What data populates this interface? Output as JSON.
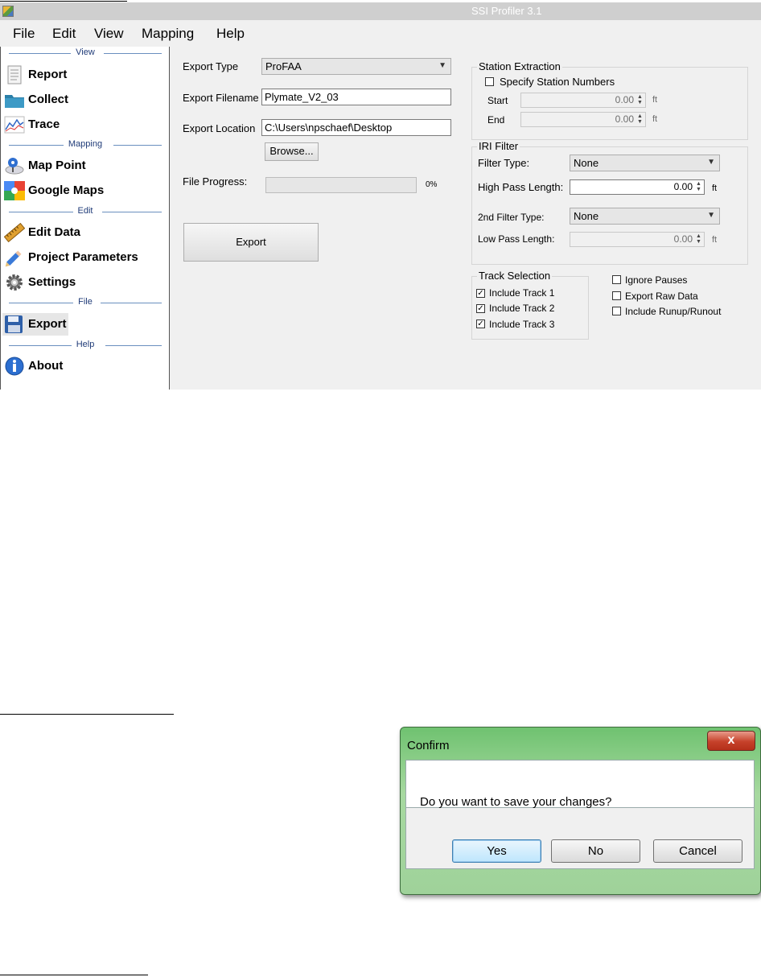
{
  "window": {
    "title": "SSI Profiler 3.1"
  },
  "menu": [
    "File",
    "Edit",
    "View",
    "Mapping",
    "Help"
  ],
  "sidebar": {
    "sections": [
      {
        "label": "View"
      },
      {
        "label": "Mapping"
      },
      {
        "label": "Edit"
      },
      {
        "label": "File"
      },
      {
        "label": "Help"
      }
    ],
    "items": [
      {
        "label": "Report",
        "icon": "report-icon"
      },
      {
        "label": "Collect",
        "icon": "folder-icon"
      },
      {
        "label": "Trace",
        "icon": "trace-chart-icon"
      },
      {
        "label": "Map Point",
        "icon": "map-pin-icon"
      },
      {
        "label": "Google Maps",
        "icon": "google-maps-icon"
      },
      {
        "label": "Edit Data",
        "icon": "ruler-icon"
      },
      {
        "label": "Project Parameters",
        "icon": "pencil-icon"
      },
      {
        "label": "Settings",
        "icon": "gear-icon"
      },
      {
        "label": "Export",
        "icon": "floppy-disk-icon",
        "active": true
      },
      {
        "label": "About",
        "icon": "info-icon"
      }
    ]
  },
  "export": {
    "type_label": "Export Type",
    "type_value": "ProFAA",
    "filename_label": "Export Filename",
    "filename_value": "Plymate_V2_03",
    "location_label": "Export Location",
    "location_value": "C:\\Users\\npschaef\\Desktop",
    "browse_label": "Browse...",
    "progress_label": "File Progress:",
    "progress_text": "0%",
    "progress_fraction": 0,
    "export_button": "Export"
  },
  "station_extraction": {
    "title": "Station Extraction",
    "specify_label": "Specify Station Numbers",
    "specify_checked": false,
    "start_label": "Start",
    "start_value": "0.00",
    "end_label": "End",
    "end_value": "0.00",
    "unit": "ft"
  },
  "iri_filter": {
    "title": "IRI Filter",
    "filter_type_label": "Filter Type:",
    "filter_type_value": "None",
    "high_pass_label": "High Pass Length:",
    "high_pass_value": "0.00",
    "second_filter_label": "2nd Filter Type:",
    "second_filter_value": "None",
    "low_pass_label": "Low Pass Length:",
    "low_pass_value": "0.00",
    "unit": "ft"
  },
  "track_selection": {
    "title": "Track Selection",
    "tracks": [
      {
        "label": "Include Track 1",
        "checked": true
      },
      {
        "label": "Include Track 2",
        "checked": true
      },
      {
        "label": "Include Track 3",
        "checked": true
      }
    ]
  },
  "options": [
    {
      "label": "Ignore Pauses",
      "checked": false
    },
    {
      "label": "Export Raw Data",
      "checked": false
    },
    {
      "label": "Include Runup/Runout",
      "checked": false
    }
  ],
  "dialog": {
    "title": "Confirm",
    "close_glyph": "x",
    "message": "Do you want to save your changes?",
    "yes": "Yes",
    "no": "No",
    "cancel": "Cancel"
  }
}
